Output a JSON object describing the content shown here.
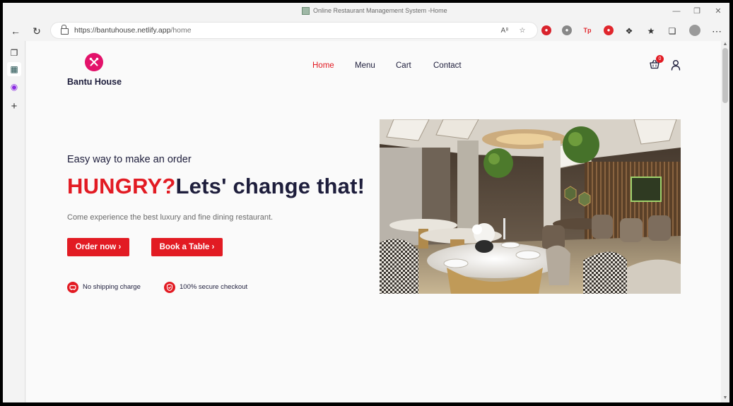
{
  "browser": {
    "window_title": "Online Restaurant Management System -Home",
    "url_host": "https://bantuhouse.netlify.app",
    "url_path": "/home",
    "extensions": [
      {
        "name": "adblock-icon",
        "color": "#d9232d"
      },
      {
        "name": "shield-grey-icon",
        "color": "#888888"
      },
      {
        "name": "tp-icon",
        "color": "#e0262c",
        "label": "Tp"
      },
      {
        "name": "red-drop-icon",
        "color": "#e0262c"
      }
    ]
  },
  "site": {
    "brand": "Bantu House",
    "nav": [
      "Home",
      "Menu",
      "Cart",
      "Contact"
    ],
    "active_nav": "Home",
    "cart_count": "0",
    "accent": "#e21b23",
    "logo_color": "#e3126a",
    "text_color": "#1e1e3c"
  },
  "hero": {
    "subtitle": "Easy way to make an order",
    "headline_red": "HUNGRY?",
    "headline_dark": "Lets' change that!",
    "description": "Come experience the best luxury and fine dining restaurant.",
    "order_button": "Order now",
    "book_button": "Book a Table",
    "features": [
      {
        "icon": "car-icon",
        "text": "No shipping charge"
      },
      {
        "icon": "shield-check-icon",
        "text": "100% secure checkout"
      }
    ]
  }
}
